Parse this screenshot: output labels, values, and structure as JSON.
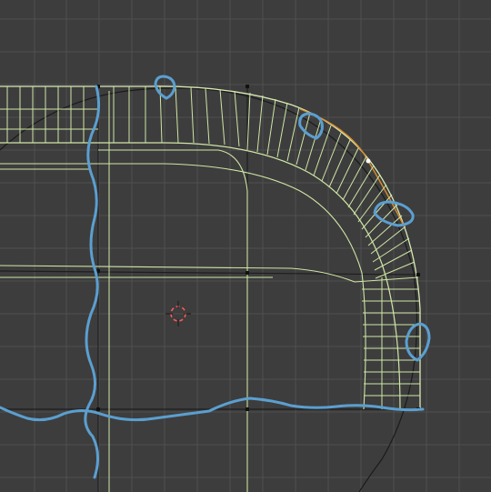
{
  "viewport": {
    "background": "#3d3d3d",
    "grid_color": "#4f4f4f",
    "mesh_edge_color": "#cfe7a8",
    "selected_edge_color": "#e0a040",
    "circle_color": "#141414",
    "annotation_color": "#5b9fd0",
    "cursor_colors": [
      "#ff5a5a",
      "#ffffff"
    ]
  }
}
